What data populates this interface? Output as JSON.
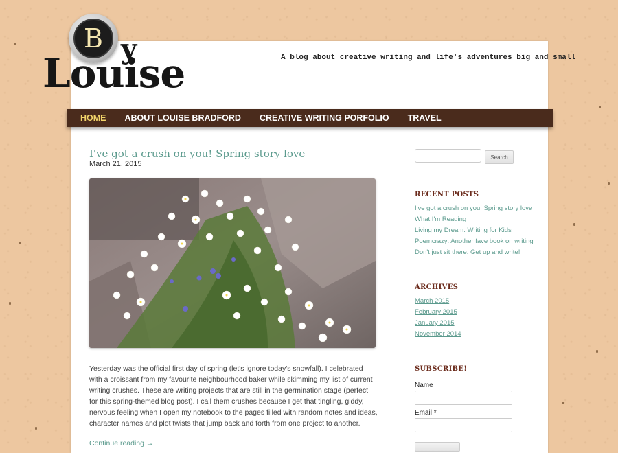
{
  "site": {
    "logo_letter": "B",
    "logo_y": "y",
    "logo_name": "Louise",
    "tagline": "A blog about creative writing and life's adventures big and small"
  },
  "nav": {
    "items": [
      {
        "label": "HOME",
        "active": true
      },
      {
        "label": "ABOUT LOUISE BRADFORD",
        "active": false
      },
      {
        "label": "CREATIVE WRITING PORFOLIO",
        "active": false
      },
      {
        "label": "TRAVEL",
        "active": false
      }
    ]
  },
  "post": {
    "title": "I've got a crush on you! Spring story love",
    "date": "March 21, 2015",
    "body": "Yesterday was the official first day of spring (let's ignore today's snowfall). I celebrated with a croissant from my favourite neighbourhood baker while skimming my list of current writing crushes. These are writing projects that are still in the germination stage (perfect for this spring-themed blog post). I call them crushes because I get that tingling, giddy, nervous feeling when I open my notebook to the pages filled with random notes and ideas, character names and plot twists that jump back and forth from one project to another.",
    "continue_label": "Continue reading →"
  },
  "sidebar": {
    "search_button": "Search",
    "recent_posts": {
      "title": "RECENT POSTS",
      "items": [
        "I've got a crush on you! Spring story love",
        "What I'm Reading",
        "Living my Dream: Writing for Kids",
        "Poemcrazy: Another fave book on writing",
        "Don't just sit there. Get up and write!"
      ]
    },
    "archives": {
      "title": "ARCHIVES",
      "items": [
        "March 2015",
        "February 2015",
        "January 2015",
        "November 2014"
      ]
    },
    "subscribe": {
      "title": "SUBSCRIBE!",
      "name_label": "Name",
      "email_label": "Email *"
    }
  },
  "colors": {
    "nav_bg": "#4a2b1c",
    "nav_active": "#f2d46a",
    "link": "#5b9a8d",
    "widget_title": "#6b2b1c"
  }
}
